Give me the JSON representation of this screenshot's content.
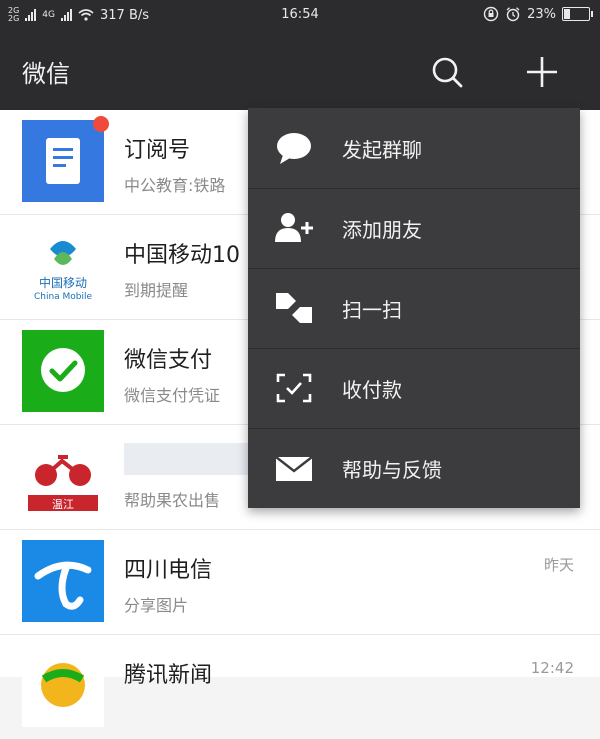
{
  "statusbar": {
    "net_top": "2G",
    "net_bottom": "2G",
    "net_type": "4G",
    "speed": "317 B/s",
    "time": "16:54",
    "battery": "23%",
    "battery_level": 0.23
  },
  "navbar": {
    "title": "微信"
  },
  "chats": [
    {
      "name": "订阅号",
      "preview": "中公教育:铁路",
      "time": "",
      "avatar": "subscription-icon",
      "unread": true
    },
    {
      "name": "中国移动10",
      "preview": "到期提醒",
      "time": "",
      "avatar": "china-mobile-logo",
      "logo_cn": "中国移动",
      "logo_en": "China Mobile"
    },
    {
      "name": "微信支付",
      "preview": "微信支付凭证",
      "time": "",
      "avatar": "wechat-pay-icon"
    },
    {
      "name": "",
      "preview": "帮助果农出售",
      "time": "",
      "avatar": "wenjiang-logo",
      "logo_text": "温江"
    },
    {
      "name": "四川电信",
      "preview": "分享图片",
      "time": "昨天",
      "avatar": "china-telecom-logo"
    },
    {
      "name": "腾讯新闻",
      "preview": "",
      "time": "12:42",
      "avatar": "tencent-news-logo"
    }
  ],
  "menu": [
    {
      "label": "发起群聊",
      "icon": "group-chat-icon"
    },
    {
      "label": "添加朋友",
      "icon": "add-friend-icon"
    },
    {
      "label": "扫一扫",
      "icon": "scan-icon"
    },
    {
      "label": "收付款",
      "icon": "payment-icon"
    },
    {
      "label": "帮助与反馈",
      "icon": "feedback-icon"
    }
  ],
  "colors": {
    "bar_bg": "#2c2c2e",
    "menu_bg": "#3c3c3e",
    "wechat_green": "#1aad19",
    "subscription_blue": "#3478e0",
    "badge_red": "#f04b3a"
  }
}
